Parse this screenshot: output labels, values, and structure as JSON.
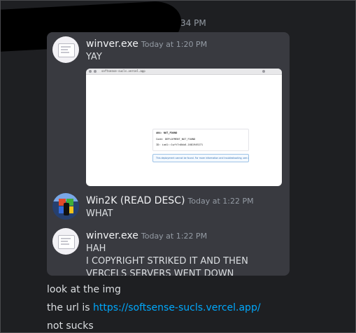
{
  "header": {
    "redacted_time_fragment": "34 PM"
  },
  "quote": {
    "messages": [
      {
        "username": "winver.exe",
        "timestamp": "Today at 1:20 PM",
        "text": "YAY",
        "attachment": {
          "url_text": "softsense-sucls.vercel.app",
          "error_title": "404: NOT_FOUND",
          "error_code": "Code: DEPLOYMENT_NOT_FOUND",
          "error_id": "ID: iad1::1wft7n8kk6-1681949271",
          "note": "This deployment cannot be found. For more information and troubleshooting, see our documentation."
        }
      },
      {
        "username": "Win2K (READ DESC)",
        "timestamp": "Today at 1:22 PM",
        "text": "WHAT"
      },
      {
        "username": "winver.exe",
        "timestamp": "Today at 1:22 PM",
        "text": "HAH\nI COPYRIGHT STRIKED IT AND THEN VERCELS SERVERS WENT DOWN"
      }
    ]
  },
  "comment": {
    "line1": "look at the img",
    "line2_prefix": "the url is ",
    "line2_link": "https://softsense-sucls.vercel.app/",
    "line3": "not sucks"
  },
  "colors": {
    "background": "#1e1f22",
    "card": "#393a40",
    "link": "#00a8fc",
    "timestamp": "#949ba4"
  }
}
